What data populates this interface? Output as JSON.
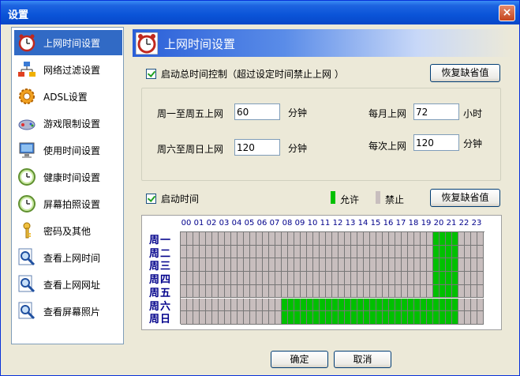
{
  "window": {
    "title": "设置",
    "close_symbol": "×"
  },
  "sidebar": {
    "items": [
      {
        "label": "上网时间设置",
        "icon": "alarm-clock-icon",
        "active": true
      },
      {
        "label": "网络过滤设置",
        "icon": "network-icon",
        "active": false
      },
      {
        "label": "ADSL设置",
        "icon": "gear-icon",
        "active": false
      },
      {
        "label": "游戏限制设置",
        "icon": "gamepad-icon",
        "active": false
      },
      {
        "label": "使用时间设置",
        "icon": "monitor-icon",
        "active": false
      },
      {
        "label": "健康时间设置",
        "icon": "clock-icon",
        "active": false
      },
      {
        "label": "屏幕拍照设置",
        "icon": "clock-icon",
        "active": false
      },
      {
        "label": "密码及其他",
        "icon": "key-icon",
        "active": false
      },
      {
        "label": "查看上网时间",
        "icon": "magnifier-icon",
        "active": false
      },
      {
        "label": "查看上网网址",
        "icon": "magnifier-icon",
        "active": false
      },
      {
        "label": "查看屏幕照片",
        "icon": "magnifier-icon",
        "active": false
      }
    ]
  },
  "header": {
    "title": "上网时间设置"
  },
  "total_control": {
    "checkbox_label": "启动总时间控制（超过设定时间禁止上网 ）",
    "checked": true,
    "restore_label": "恢复缺省值"
  },
  "limits": {
    "weekday_label": "周一至周五上网",
    "weekday_value": "60",
    "weekday_unit": "分钟",
    "weekend_label": "周六至周日上网",
    "weekend_value": "120",
    "weekend_unit": "分钟",
    "monthly_label": "每月上网",
    "monthly_value": "72",
    "monthly_unit": "小时",
    "session_label": "每次上网",
    "session_value": "120",
    "session_unit": "分钟"
  },
  "schedule": {
    "checkbox_label": "启动时间",
    "checked": true,
    "allow_label": "允许",
    "deny_label": "禁止",
    "restore_label": "恢复缺省值",
    "allow_color": "#00C000",
    "deny_color": "#C8BEBE",
    "hours": [
      "00",
      "01",
      "02",
      "03",
      "04",
      "05",
      "06",
      "07",
      "08",
      "09",
      "10",
      "11",
      "12",
      "13",
      "14",
      "15",
      "16",
      "17",
      "18",
      "19",
      "20",
      "21",
      "22",
      "23"
    ],
    "days": [
      "周一",
      "周二",
      "周三",
      "周四",
      "周五",
      "周六",
      "周日"
    ],
    "allowed": [
      [
        20,
        21
      ],
      [
        20,
        21
      ],
      [
        20,
        21
      ],
      [
        20,
        21
      ],
      [
        20,
        21
      ],
      [
        8,
        9,
        10,
        11,
        12,
        13,
        14,
        15,
        16,
        17,
        18,
        19,
        20,
        21
      ],
      [
        8,
        9,
        10,
        11,
        12,
        13,
        14,
        15,
        16,
        17,
        18,
        19,
        20,
        21
      ]
    ]
  },
  "footer": {
    "ok_label": "确定",
    "cancel_label": "取消"
  }
}
